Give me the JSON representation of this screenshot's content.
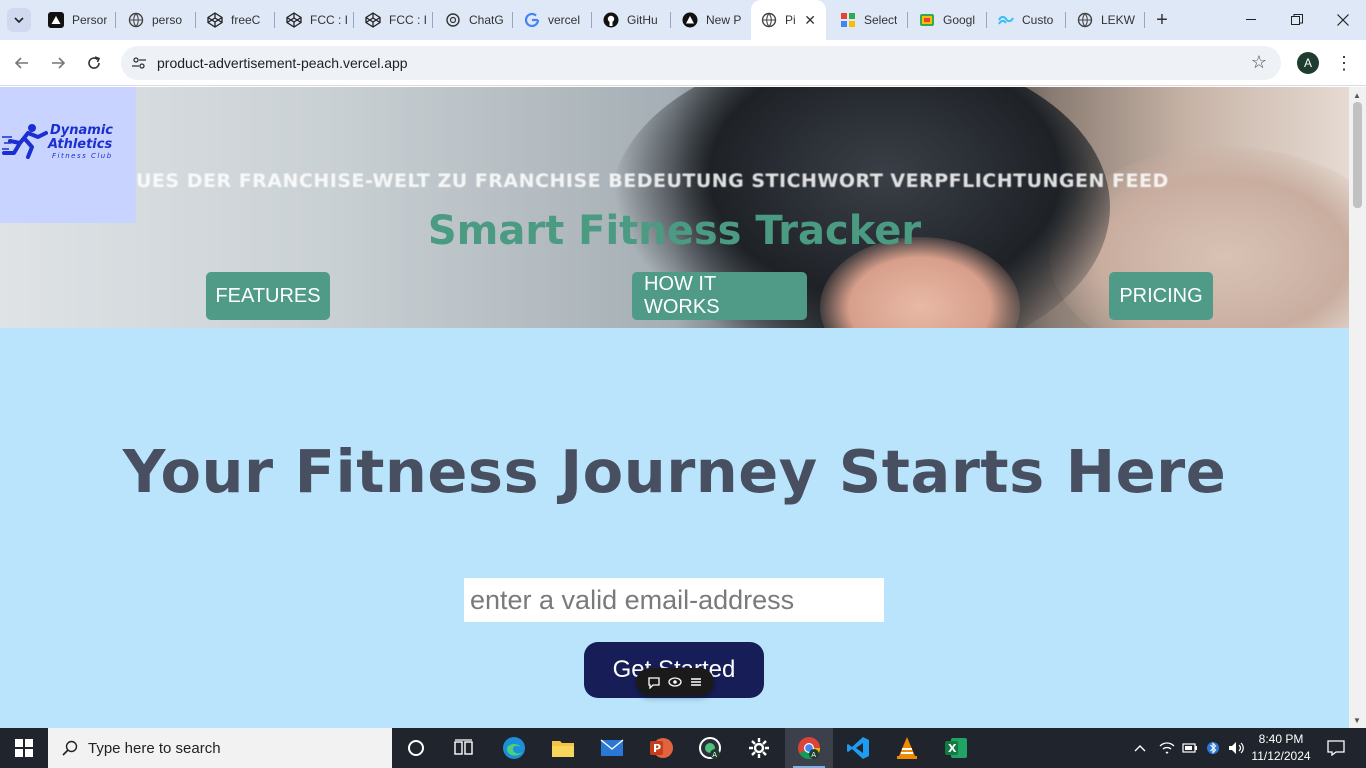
{
  "browser": {
    "tabs": [
      {
        "title": "Persor",
        "icon": "vercel-triangle-icon"
      },
      {
        "title": "perso",
        "icon": "globe-icon"
      },
      {
        "title": "freeC",
        "icon": "codepen-icon"
      },
      {
        "title": "FCC : I",
        "icon": "codepen-icon"
      },
      {
        "title": "FCC : I",
        "icon": "codepen-icon"
      },
      {
        "title": "ChatG",
        "icon": "chatgpt-icon"
      },
      {
        "title": "vercel",
        "icon": "google-icon"
      },
      {
        "title": "GitHu",
        "icon": "github-icon"
      },
      {
        "title": "New P",
        "icon": "vercel-triangle-icon"
      },
      {
        "title": "Pi",
        "icon": "globe-icon",
        "active": true
      },
      {
        "title": "Select",
        "icon": "color-grid-icon"
      },
      {
        "title": "Googl",
        "icon": "google-slides-icon"
      },
      {
        "title": "Custo",
        "icon": "tailwind-icon"
      },
      {
        "title": "LEKW",
        "icon": "globe-icon"
      }
    ],
    "new_tab_label": "+",
    "address": "product-advertisement-peach.vercel.app",
    "profile_initial": "A"
  },
  "page": {
    "logo": {
      "line1": "Dynamic",
      "line2": "Athletics",
      "line3": "Fitness Club"
    },
    "marquee_text": "UES DER FRANCHISE-WELT ZU FRANCHISE BEDEUTUNG STICHWORT VERPFLICHTUNGEN FEED",
    "site_title": "Smart Fitness Tracker",
    "nav": {
      "features": "FEATURES",
      "how_it_works": "HOW IT WORKS",
      "pricing": "PRICING"
    },
    "headline": "Your Fitness Journey Starts Here",
    "email": {
      "placeholder": "enter a valid email-address",
      "value": ""
    },
    "cta_label": "Get Started"
  },
  "taskbar": {
    "search_placeholder": "Type here to search",
    "time": "8:40 PM",
    "date": "11/12/2024"
  },
  "colors": {
    "page_bg": "#b9e4fb",
    "title_green": "#4b9a82",
    "nav_green": "#4f9b88",
    "cta_navy": "#171e57",
    "headline_gray": "#474f60",
    "logo_blue": "#1b2fd1"
  }
}
